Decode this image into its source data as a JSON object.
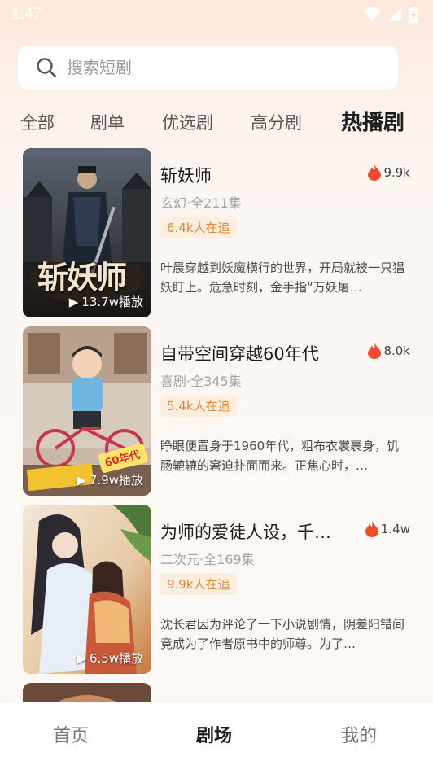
{
  "status": {
    "time": "1:47"
  },
  "search": {
    "placeholder": "搜索短剧"
  },
  "tabs": [
    {
      "label": "全部"
    },
    {
      "label": "剧单"
    },
    {
      "label": "优选剧"
    },
    {
      "label": "高分剧"
    },
    {
      "label": "热播剧",
      "active": true
    }
  ],
  "dramas": [
    {
      "title": "斩妖师",
      "heat": "9.9k",
      "meta": "玄幻·全211集",
      "chasing": "6.4k人在追",
      "description": "叶晨穿越到妖魔横行的世界，开局就被一只猖妖盯上。危急时刻，金手指“万妖屠…",
      "plays": "13.7w播放",
      "poster_text": "斩妖师"
    },
    {
      "title": "自带空间穿越60年代",
      "heat": "8.0k",
      "meta": "喜剧·全345集",
      "chasing": "5.4k人在追",
      "description": "睁眼便置身于1960年代，粗布衣裳裹身，饥肠辘辘的窘迫扑面而来。正焦心时，…",
      "plays": "7.9w播放",
      "poster_text": "60年代"
    },
    {
      "title": "为师的爱徒人设，千…",
      "heat": "1.4w",
      "meta": "二次元·全169集",
      "chasing": "9.9k人在追",
      "description": "沈长君因为评论了一下小说剧情，阴差阳错间竟成为了作者原书中的师尊。为了…",
      "plays": "6.5w播放",
      "poster_text": ""
    }
  ],
  "bottom_nav": [
    {
      "label": "首页"
    },
    {
      "label": "剧场",
      "active": true
    },
    {
      "label": "我的"
    }
  ],
  "colors": {
    "accent_flame": "#f04a2f",
    "chasing_text": "#d98a3c",
    "chasing_bg": "#fdeee0"
  }
}
